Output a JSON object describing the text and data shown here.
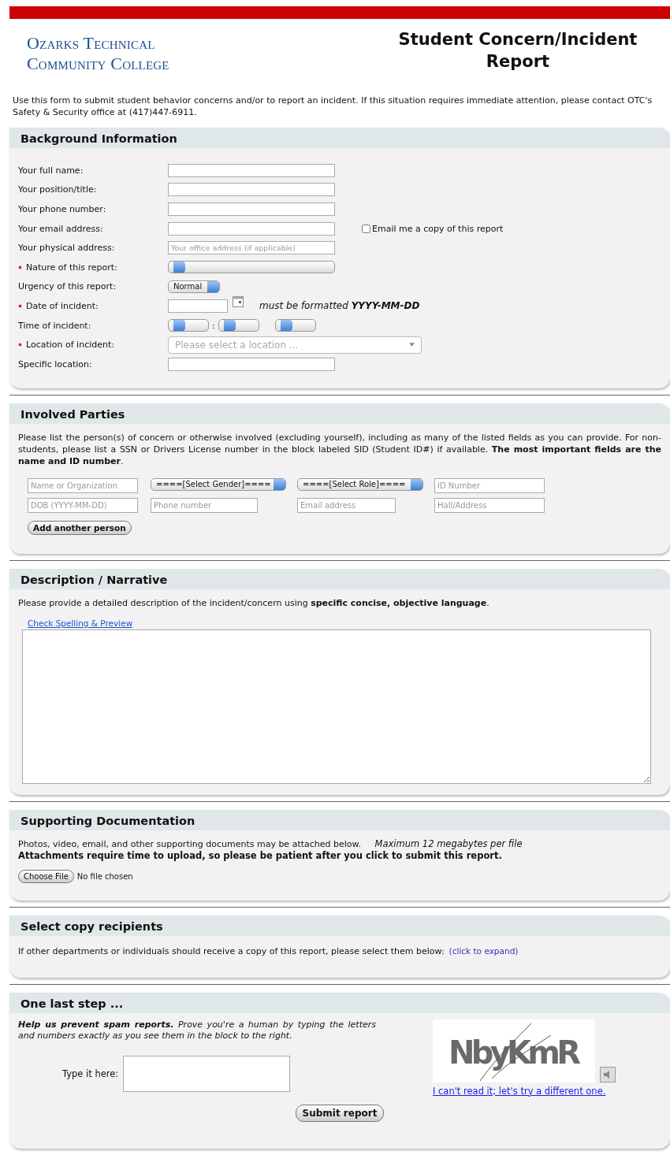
{
  "header": {
    "logo_lines": [
      "Ozarks Technical",
      "Community College"
    ],
    "title": "Student Concern/Incident Report",
    "intro": "Use this form to submit student behavior concerns and/or to report an incident. If this situation requires immediate attention, please contact OTC's Safety & Security office at (417)447-6911."
  },
  "background": {
    "title": "Background Information",
    "rows": [
      {
        "label": "Your full name:",
        "required": false,
        "kind": "text"
      },
      {
        "label": "Your position/title:",
        "required": false,
        "kind": "text"
      },
      {
        "label": "Your phone number:",
        "required": false,
        "kind": "text"
      },
      {
        "label": "Your email address:",
        "required": false,
        "kind": "text",
        "option": {
          "label": "Email me a copy of this report",
          "checked": false
        }
      },
      {
        "label": "Your physical address:",
        "required": false,
        "kind": "text",
        "placeholder": "Your office address (if applicable)"
      },
      {
        "label": "Nature of this report:",
        "required": true,
        "kind": "select"
      },
      {
        "label": "Urgency of this report:",
        "required": false,
        "kind": "select",
        "value": "Normal"
      },
      {
        "label": "Date of incident:",
        "required": true,
        "kind": "date",
        "hint": "must be formatted **YYYY-MM-DD**"
      },
      {
        "label": "Time of incident:",
        "required": false,
        "kind": "time",
        "separator": ":"
      },
      {
        "label": "Location of incident:",
        "required": true,
        "kind": "combo",
        "placeholder": "Please select a location ..."
      },
      {
        "label": "Specific location:",
        "required": false,
        "kind": "text"
      }
    ]
  },
  "parties": {
    "title": "Involved Parties",
    "intro": "Please list the person(s) of concern or otherwise involved (excluding yourself), including as many of the listed fields as you can provide. For non-students, please list a SSN or Drivers License number in the block labeled SID (Student ID#) if available. **The most important fields are the name and ID number**.",
    "fields": [
      {
        "kind": "text",
        "placeholder": "Name or Organization"
      },
      {
        "kind": "select",
        "value": "====[Select Gender]===="
      },
      {
        "kind": "select",
        "value": "====[Select Role]===="
      },
      {
        "kind": "text",
        "placeholder": "ID Number"
      },
      {
        "kind": "text",
        "placeholder": "DOB (YYYY-MM-DD)"
      },
      {
        "kind": "text",
        "placeholder": "Phone number"
      },
      {
        "kind": "text",
        "placeholder": "Email address"
      },
      {
        "kind": "text",
        "placeholder": "Hall/Address"
      }
    ],
    "button": "Add another person"
  },
  "description": {
    "title": "Description / Narrative",
    "intro": "Please provide a detailed description of the incident/concern using **specific concise, objective language**.",
    "link": "Check Spelling & Preview"
  },
  "supporting": {
    "title": "Supporting Documentation",
    "text": "Photos, video, email, and other supporting documents may be attached below.",
    "note": "Maximum 12 megabytes per file",
    "warning": "Attachments require time to upload, so please be patient after you click to submit this report.",
    "file_button": "Choose File",
    "file_status": "No file chosen"
  },
  "recipients": {
    "title": "Select copy recipients",
    "text": "If other departments or individuals should receive a copy of this report, please select them below:",
    "link": "(click to expand)"
  },
  "last_step": {
    "title": "One last step ...",
    "text": "**Help us prevent spam reports.** Prove you're a human by typing the letters and numbers exactly as you see them in the block to the right.",
    "field_label": "Type it here:",
    "captcha_text": "NbyKmR",
    "captcha_link": "I can't read it; let's try a different one.",
    "submit": "Submit report"
  }
}
